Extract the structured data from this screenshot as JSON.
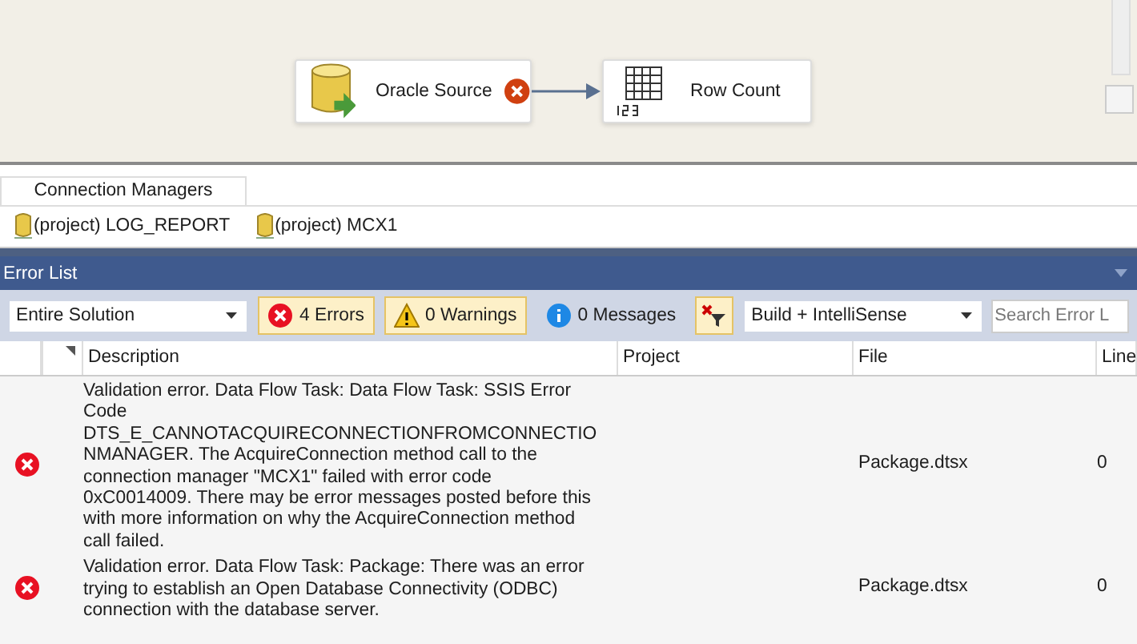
{
  "canvas": {
    "nodes": [
      {
        "label": "Oracle Source",
        "kind": "source",
        "error": true
      },
      {
        "label": "Row Count",
        "kind": "rowcount",
        "error": false
      }
    ]
  },
  "connection_managers": {
    "tab": "Connection Managers",
    "items": [
      "(project) LOG_REPORT",
      "(project) MCX1"
    ]
  },
  "error_list": {
    "title": "Error List",
    "scope": "Entire Solution",
    "filters": [
      {
        "label": "4 Errors",
        "kind": "error",
        "selected": true
      },
      {
        "label": "0 Warnings",
        "kind": "warning",
        "selected": true
      },
      {
        "label": "0 Messages",
        "kind": "info",
        "selected": false
      }
    ],
    "build_filter": "Build + IntelliSense",
    "search": {
      "placeholder": "Search Error L"
    },
    "columns": [
      "Description",
      "Project",
      "File",
      "Line"
    ],
    "rows": [
      {
        "kind": "error",
        "description": "Validation error. Data Flow Task: Data Flow Task: SSIS Error Code DTS_E_CANNOTACQUIRECONNECTIONFROMCONNECTIONMANAGER.  The AcquireConnection method call to the connection manager \"MCX1\" failed with error code 0xC0014009.  There may be error messages posted before this with more information on why the AcquireConnection method call failed.",
        "file": "Package.dtsx",
        "line": "0"
      },
      {
        "kind": "error",
        "description": "Validation error. Data Flow Task: Package: There was an error trying to establish an Open Database Connectivity (ODBC) connection with the database server.",
        "file": "Package.dtsx",
        "line": "0"
      }
    ]
  }
}
